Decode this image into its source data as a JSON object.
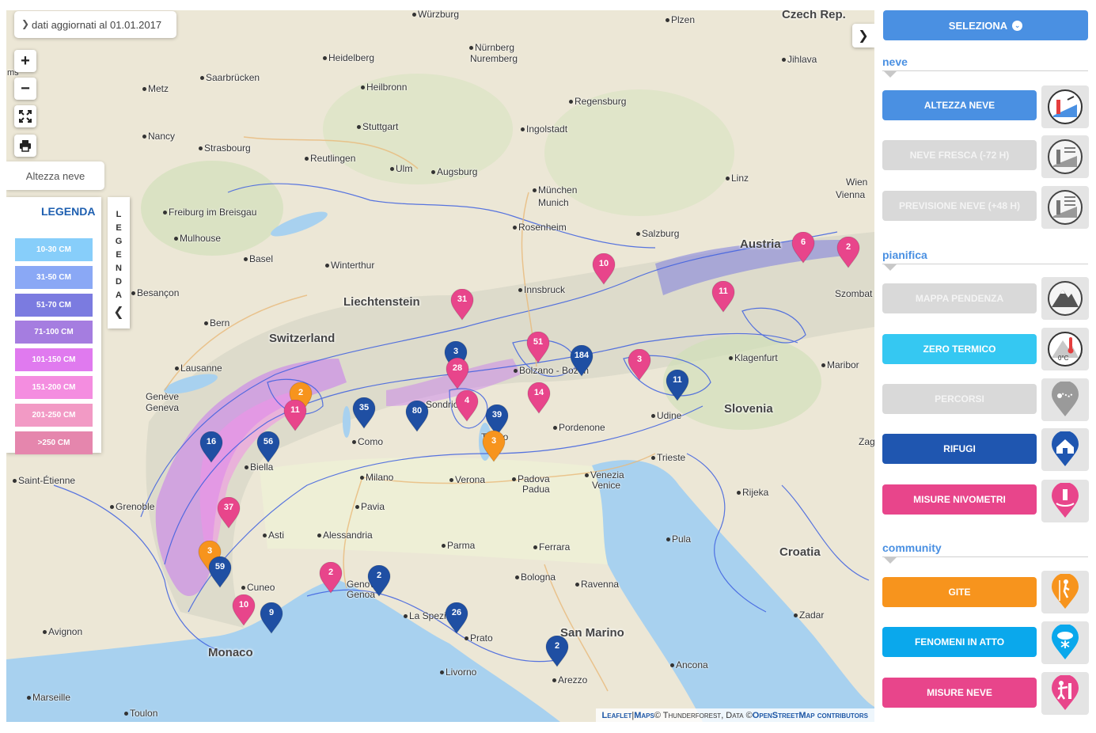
{
  "map": {
    "update_note": "dati aggiornati al 01.01.2017",
    "layer_name": "Altezza neve",
    "zoom_in": "+",
    "zoom_out": "−",
    "scale_fragment": "ms",
    "attribution": {
      "leaflet": "Leaflet",
      "sep": " | ",
      "maps": "Maps",
      "rest": " © Thunderforest, Data © ",
      "osm": "OpenStreetMap contributors"
    },
    "countries": [
      "Czech Rep.",
      "Austria",
      "Switzerland",
      "Liechtenstein",
      "Slovenia",
      "Croatia",
      "Monaco",
      "San Marino"
    ],
    "cities": [
      "Würzburg",
      "Plzen",
      "Heidelberg",
      "Nürnberg",
      "Nuremberg",
      "Jihlava",
      "Saarbrücken",
      "Heilbronn",
      "Metz",
      "Regensburg",
      "Stuttgart",
      "Ingolstadt",
      "Nancy",
      "Strasbourg",
      "Reutlingen",
      "Ulm",
      "Augsburg",
      "Linz",
      "Wien",
      "Vienna",
      "München",
      "Munich",
      "Freiburg im Breisgau",
      "Rosenheim",
      "Salzburg",
      "Mulhouse",
      "Basel",
      "Winterthur",
      "Szombat",
      "Besançon",
      "Innsbruck",
      "Bern",
      "Bolzano - Bozen",
      "Klagenfurt",
      "Maribor",
      "Lausanne",
      "Genève",
      "Geneva",
      "Sondrio",
      "Udine",
      "Pordenone",
      "Zagr",
      "Como",
      "Trento",
      "Biella",
      "Trieste",
      "Milano",
      "Saint-Étienne",
      "Verona",
      "Padova",
      "Padua",
      "Venezia",
      "Venice",
      "Rijeka",
      "Grenoble",
      "Pavia",
      "Asti",
      "Alessandria",
      "Parma",
      "Ferrara",
      "Pula",
      "Cuneo",
      "Genova",
      "Genoa",
      "Bologna",
      "Ravenna",
      "Zadar",
      "Avignon",
      "La Spezia",
      "Prato",
      "Ancona",
      "Livorno",
      "Arezzo",
      "Marseille",
      "Toulon"
    ]
  },
  "legend": {
    "title": "LEGENDA",
    "tab_letters": [
      "L",
      "E",
      "G",
      "E",
      "N",
      "D",
      "A"
    ],
    "items": [
      {
        "label": "10-30 CM",
        "color": "#87cefa"
      },
      {
        "label": "31-50 CM",
        "color": "#8aa8f5"
      },
      {
        "label": "51-70 CM",
        "color": "#7b7be0"
      },
      {
        "label": "71-100 CM",
        "color": "#a57de0"
      },
      {
        "label": "101-150 CM",
        "color": "#e07aef"
      },
      {
        "label": "151-200 CM",
        "color": "#f48de0"
      },
      {
        "label": "201-250 CM",
        "color": "#f29ac5"
      },
      {
        "label": ">250 CM",
        "color": "#e586ad"
      }
    ]
  },
  "markers": [
    {
      "label": "6",
      "color": "#e8458b"
    },
    {
      "label": "2",
      "color": "#e8458b"
    },
    {
      "label": "10",
      "color": "#e8458b"
    },
    {
      "label": "11",
      "color": "#e8458b"
    },
    {
      "label": "31",
      "color": "#e8458b"
    },
    {
      "label": "3",
      "color": "#1f4fa3"
    },
    {
      "label": "28",
      "color": "#e8458b"
    },
    {
      "label": "51",
      "color": "#e8458b"
    },
    {
      "label": "184",
      "color": "#1f4fa3"
    },
    {
      "label": "3",
      "color": "#e8458b"
    },
    {
      "label": "11",
      "color": "#1f4fa3"
    },
    {
      "label": "14",
      "color": "#e8458b"
    },
    {
      "label": "2",
      "color": "#f7941d"
    },
    {
      "label": "11",
      "color": "#e8458b"
    },
    {
      "label": "35",
      "color": "#1f4fa3"
    },
    {
      "label": "80",
      "color": "#1f4fa3"
    },
    {
      "label": "4",
      "color": "#e8458b"
    },
    {
      "label": "39",
      "color": "#1f4fa3"
    },
    {
      "label": "3",
      "color": "#f7941d"
    },
    {
      "label": "16",
      "color": "#1f4fa3"
    },
    {
      "label": "56",
      "color": "#1f4fa3"
    },
    {
      "label": "37",
      "color": "#e8458b"
    },
    {
      "label": "3",
      "color": "#f7941d"
    },
    {
      "label": "59",
      "color": "#1f4fa3"
    },
    {
      "label": "2",
      "color": "#e8458b"
    },
    {
      "label": "2",
      "color": "#1f4fa3"
    },
    {
      "label": "10",
      "color": "#e8458b"
    },
    {
      "label": "9",
      "color": "#1f4fa3"
    },
    {
      "label": "26",
      "color": "#1f4fa3"
    },
    {
      "label": "2",
      "color": "#1f4fa3"
    }
  ],
  "sidebar": {
    "select_label": "SELEZIONA",
    "sections": {
      "neve": "neve",
      "pianifica": "pianifica",
      "community": "community"
    },
    "buttons": [
      {
        "label": "ALTEZZA NEVE",
        "color": "#4a90e2",
        "active": true
      },
      {
        "label": "NEVE FRESCA (-72 H)",
        "color": "#d9d9d9",
        "active": false
      },
      {
        "label": "PREVISIONE NEVE (+48 H)",
        "color": "#d9d9d9",
        "active": false
      },
      {
        "label": "MAPPA PENDENZA",
        "color": "#d9d9d9",
        "active": false
      },
      {
        "label": "ZERO TERMICO",
        "color": "#35c8f2",
        "active": true
      },
      {
        "label": "PERCORSI",
        "color": "#d9d9d9",
        "active": false
      },
      {
        "label": "RIFUGI",
        "color": "#1f56b0",
        "active": true
      },
      {
        "label": "MISURE NIVOMETRI",
        "color": "#e8458b",
        "active": true
      },
      {
        "label": "GITE",
        "color": "#f7941d",
        "active": true
      },
      {
        "label": "FENOMENI IN ATTO",
        "color": "#0aa8ec",
        "active": true
      },
      {
        "label": "MISURE NEVE",
        "color": "#e8458b",
        "active": true
      }
    ],
    "icons": {
      "zero_termico_text": "0°C"
    }
  }
}
